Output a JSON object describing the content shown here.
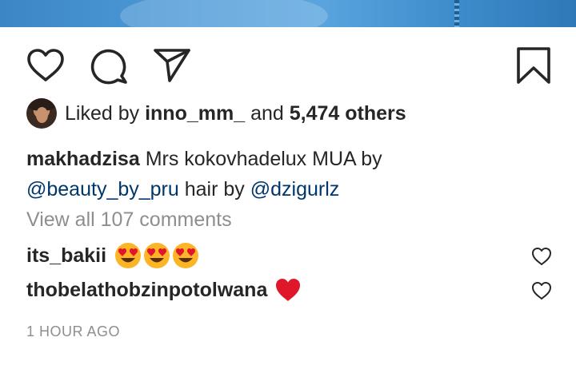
{
  "post": {
    "likes": {
      "prefix": "Liked by",
      "user": "inno_mm_",
      "conjunction": "and",
      "others": "5,474 others"
    },
    "caption": {
      "username": "makhadzisa",
      "text_1": "Mrs kokovhadelux MUA by",
      "mention_1": "@beauty_by_pru",
      "text_2": "hair by",
      "mention_2": "@dzigurlz"
    },
    "view_all": "View all 107 comments",
    "comments": [
      {
        "username": "its_bakii",
        "emoji": "heart-eyes x3"
      },
      {
        "username": "thobelathobzinpotolwana",
        "emoji": "red-heart"
      }
    ],
    "timestamp": "1 HOUR AGO"
  },
  "icons": {
    "like": "heart-outline-icon",
    "comment": "speech-bubble-icon",
    "share": "paper-plane-icon",
    "save": "bookmark-icon",
    "comment_like": "small-heart-icon"
  },
  "colors": {
    "text": "#262626",
    "secondary": "#8e8e8e",
    "link": "#00376b",
    "heart_red": "#e0162b",
    "emoji_yellow": "#fdb528"
  }
}
